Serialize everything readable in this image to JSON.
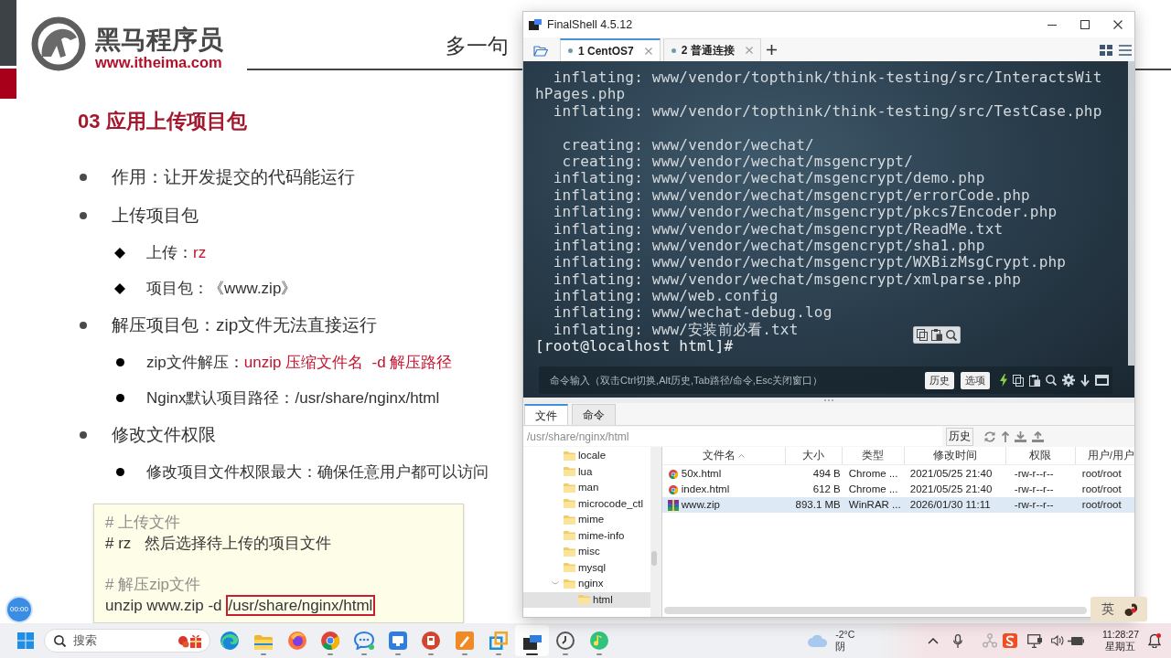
{
  "slide": {
    "logo": {
      "name": "黑马程序员",
      "url": "www.itheima.com"
    },
    "header_text": "多一句",
    "title": "03 应用上传项目包",
    "bullets": [
      {
        "parts": [
          {
            "text": "作用：让开发提交的代码能运行",
            "highlight": false
          }
        ]
      },
      {
        "parts": [
          {
            "text": "上传项目包",
            "highlight": false
          }
        ],
        "children": [
          {
            "kind": "diamond",
            "parts": [
              {
                "text": "上传：",
                "highlight": false
              },
              {
                "text": "rz",
                "highlight": true
              }
            ]
          },
          {
            "kind": "diamond",
            "parts": [
              {
                "text": "项目包：《www.zip》",
                "highlight": false
              }
            ]
          }
        ]
      },
      {
        "parts": [
          {
            "text": "解压项目包：zip文件无法直接运行",
            "highlight": false
          }
        ],
        "children": [
          {
            "kind": "dot",
            "parts": [
              {
                "text": "zip文件解压：",
                "highlight": false
              },
              {
                "text": "unzip 压缩文件名  -d 解压路径",
                "highlight": true
              }
            ]
          },
          {
            "kind": "dot",
            "parts": [
              {
                "text": "Nginx默认项目路径：/usr/share/nginx/html",
                "highlight": false
              }
            ]
          }
        ]
      },
      {
        "parts": [
          {
            "text": "修改文件权限",
            "highlight": false
          }
        ],
        "children": [
          {
            "kind": "dot",
            "parts": [
              {
                "text": "修改项目文件权限最大：确保任意用户都可以访问",
                "highlight": false
              }
            ]
          }
        ]
      }
    ],
    "code_box": {
      "lines": [
        {
          "kind": "comment",
          "text": "# 上传文件"
        },
        {
          "kind": "command",
          "text": "# rz   然后选择待上传的项目文件"
        },
        {
          "kind": "blank"
        },
        {
          "kind": "comment",
          "text": "# 解压zip文件"
        },
        {
          "kind": "command",
          "text": "unzip www.zip -d",
          "boxed_text": "/usr/share/nginx/html"
        }
      ]
    }
  },
  "video_timer": "00:00",
  "finalshell": {
    "window": {
      "title": "FinalShell 4.5.12"
    },
    "tabs": [
      {
        "label": "1 CentOS7",
        "selected": true
      },
      {
        "label": "2 普通连接",
        "selected": false
      }
    ],
    "terminal": {
      "lines": [
        {
          "kind": "output",
          "text": "  inflating: www/vendor/topthink/think-testing/src/InteractsWit"
        },
        {
          "kind": "output",
          "text": "hPages.php"
        },
        {
          "kind": "output",
          "text": "  inflating: www/vendor/topthink/think-testing/src/TestCase.php"
        },
        {
          "kind": "blank"
        },
        {
          "kind": "output",
          "text": "   creating: www/vendor/wechat/"
        },
        {
          "kind": "output",
          "text": "   creating: www/vendor/wechat/msgencrypt/"
        },
        {
          "kind": "output",
          "text": "  inflating: www/vendor/wechat/msgencrypt/demo.php"
        },
        {
          "kind": "output",
          "text": "  inflating: www/vendor/wechat/msgencrypt/errorCode.php"
        },
        {
          "kind": "output",
          "text": "  inflating: www/vendor/wechat/msgencrypt/pkcs7Encoder.php"
        },
        {
          "kind": "output",
          "text": "  inflating: www/vendor/wechat/msgencrypt/ReadMe.txt"
        },
        {
          "kind": "output",
          "text": "  inflating: www/vendor/wechat/msgencrypt/sha1.php"
        },
        {
          "kind": "output",
          "text": "  inflating: www/vendor/wechat/msgencrypt/WXBizMsgCrypt.php"
        },
        {
          "kind": "output",
          "text": "  inflating: www/vendor/wechat/msgencrypt/xmlparse.php"
        },
        {
          "kind": "output",
          "text": "  inflating: www/web.config"
        },
        {
          "kind": "output",
          "text": "  inflating: www/wechat-debug.log"
        },
        {
          "kind": "output",
          "text": "  inflating: www/安装前必看.txt"
        },
        {
          "kind": "prompt",
          "text": "[root@localhost html]#"
        }
      ]
    },
    "command_bar": {
      "placeholder": "命令输入（双击Ctrl切换,Alt历史,Tab路径/命令,Esc关闭窗口）",
      "buttons": [
        "历史",
        "选项"
      ]
    },
    "file_panel": {
      "tabs": [
        {
          "label": "文件",
          "selected": true
        },
        {
          "label": "命令",
          "selected": false
        }
      ],
      "path": "/usr/share/nginx/html",
      "history_button": "历史",
      "tree": [
        {
          "label": "locale",
          "selected": false
        },
        {
          "label": "lua",
          "selected": false
        },
        {
          "label": "man",
          "selected": false
        },
        {
          "label": "microcode_ctl",
          "selected": false
        },
        {
          "label": "mime",
          "selected": false
        },
        {
          "label": "mime-info",
          "selected": false
        },
        {
          "label": "misc",
          "selected": false
        },
        {
          "label": "mysql",
          "selected": false
        },
        {
          "label": "nginx",
          "selected": false,
          "children": [
            {
              "label": "html",
              "selected": true
            }
          ]
        }
      ],
      "table": {
        "columns": [
          {
            "label": "文件名",
            "sorted": true
          },
          {
            "label": "大小",
            "sorted": false
          },
          {
            "label": "类型",
            "sorted": false
          },
          {
            "label": "修改时间",
            "sorted": false
          },
          {
            "label": "权限",
            "sorted": false
          },
          {
            "label": "用户/用户",
            "sorted": false
          }
        ],
        "rows": [
          {
            "kind": "html",
            "selected": false,
            "cells": [
              "50x.html",
              "494 B",
              "Chrome ...",
              "2021/05/25 21:40",
              "-rw-r--r--",
              "root/root"
            ]
          },
          {
            "kind": "html",
            "selected": false,
            "cells": [
              "index.html",
              "612 B",
              "Chrome ...",
              "2021/05/25 21:40",
              "-rw-r--r--",
              "root/root"
            ]
          },
          {
            "kind": "archive",
            "selected": true,
            "cells": [
              "www.zip",
              "893.1 MB",
              "WinRAR ...",
              "2026/01/30 11:11",
              "-rw-r--r--",
              "root/root"
            ]
          }
        ]
      }
    }
  },
  "ime": {
    "mode": "英"
  },
  "taskbar": {
    "search": {
      "placeholder": "搜索"
    },
    "apps": [
      {
        "running": false,
        "selected": false
      },
      {
        "running": true,
        "selected": false
      },
      {
        "running": false,
        "selected": false
      },
      {
        "running": true,
        "selected": false
      },
      {
        "running": true,
        "selected": false
      },
      {
        "running": true,
        "selected": false
      },
      {
        "running": true,
        "selected": false
      },
      {
        "running": true,
        "selected": false
      },
      {
        "running": true,
        "selected": false
      },
      {
        "running": true,
        "selected": true
      },
      {
        "running": true,
        "selected": false
      },
      {
        "running": true,
        "selected": false
      }
    ],
    "weather": {
      "temperature": "-2°C",
      "condition": "阴"
    },
    "clock": {
      "time": "11:28:27",
      "day": "星期五"
    }
  }
}
